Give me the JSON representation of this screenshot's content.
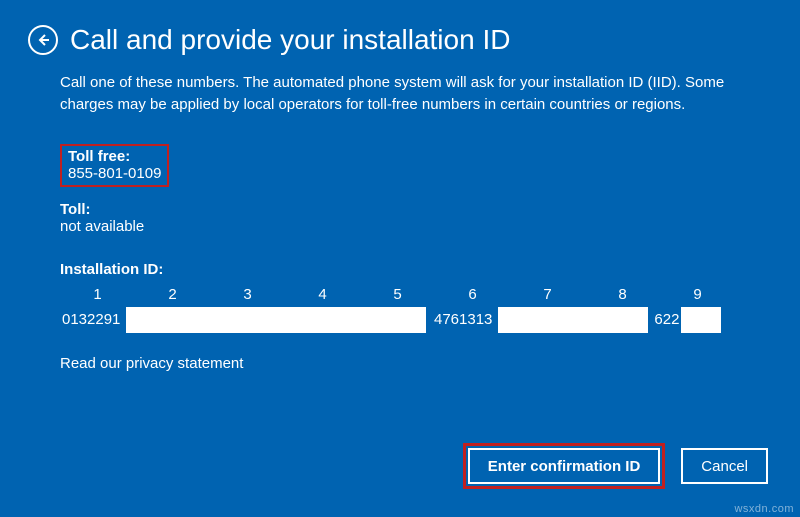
{
  "header": {
    "title": "Call and provide your installation ID"
  },
  "description": "Call one of these numbers. The automated phone system will ask for your installation ID (IID). Some charges may be applied by local operators for toll-free numbers in certain countries or regions.",
  "toll_free": {
    "label": "Toll free:",
    "number": "855-801-0109"
  },
  "toll": {
    "label": "Toll:",
    "value": "not available"
  },
  "installation_id": {
    "label": "Installation ID:",
    "columns": [
      "1",
      "2",
      "3",
      "4",
      "5",
      "6",
      "7",
      "8",
      "9"
    ],
    "segments": {
      "seg1_text": "0132291",
      "seg6_text": "4761313",
      "seg9_text": "622"
    }
  },
  "privacy_link": "Read our privacy statement",
  "buttons": {
    "enter": "Enter confirmation ID",
    "cancel": "Cancel"
  },
  "watermark": "wsxdn.com"
}
